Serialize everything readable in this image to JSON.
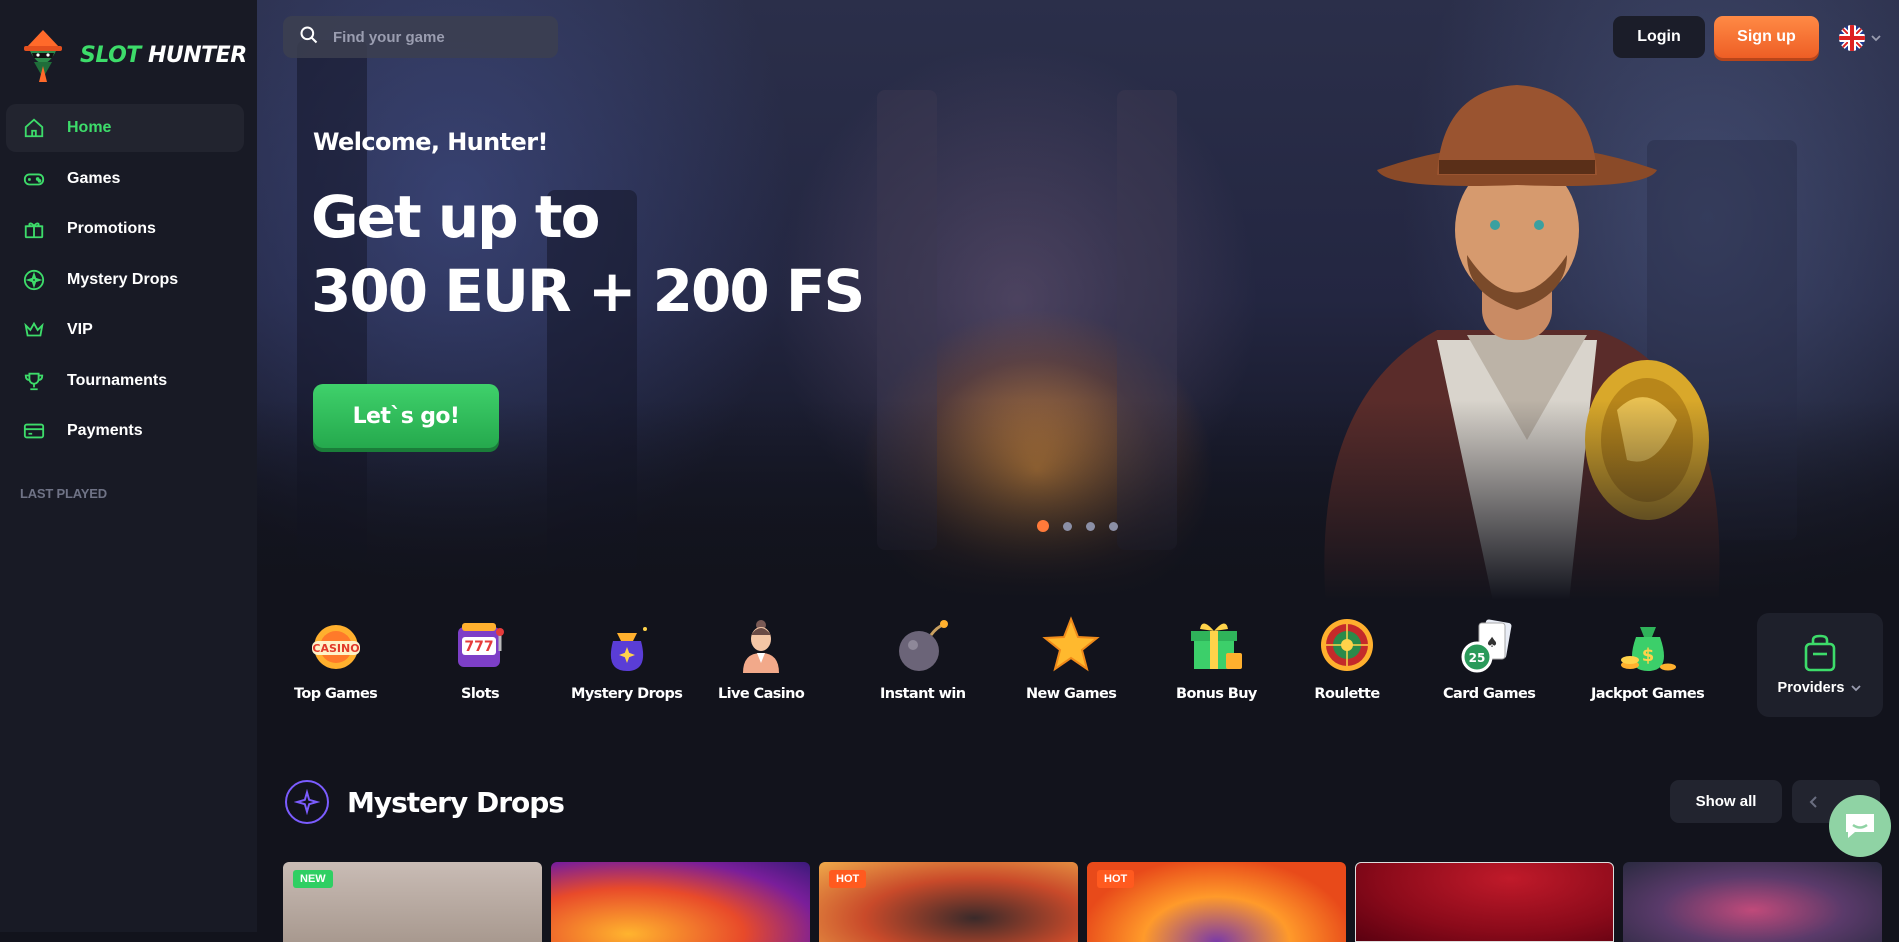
{
  "brand": {
    "part1": "SLOT",
    "part2": "HUNTER"
  },
  "nav": [
    {
      "label": "Home",
      "icon": "home-icon"
    },
    {
      "label": "Games",
      "icon": "gamepad-icon"
    },
    {
      "label": "Promotions",
      "icon": "gift-icon"
    },
    {
      "label": "Mystery Drops",
      "icon": "mystery-drops-icon"
    },
    {
      "label": "VIP",
      "icon": "crown-icon"
    },
    {
      "label": "Tournaments",
      "icon": "trophy-icon"
    },
    {
      "label": "Payments",
      "icon": "card-icon"
    }
  ],
  "last_played_label": "LAST PLAYED",
  "search": {
    "placeholder": "Find your game"
  },
  "header": {
    "login": "Login",
    "signup": "Sign up",
    "language": "flag-uk-icon"
  },
  "hero": {
    "welcome": "Welcome, Hunter!",
    "headline_line1": "Get up to",
    "headline_line2": "300 EUR + 200 FS",
    "cta": "Let`s go!",
    "slides": 4,
    "active_slide": 1
  },
  "categories": [
    {
      "label": "Top Games",
      "icon": "casino-icon"
    },
    {
      "label": "Slots",
      "icon": "slot-machine-icon"
    },
    {
      "label": "Mystery Drops",
      "icon": "mystery-bag-icon"
    },
    {
      "label": "Live Casino",
      "icon": "dealer-icon"
    },
    {
      "label": "Instant win",
      "icon": "bomb-icon"
    },
    {
      "label": "New Games",
      "icon": "star-icon"
    },
    {
      "label": "Bonus Buy",
      "icon": "gift-box-icon"
    },
    {
      "label": "Roulette",
      "icon": "roulette-icon"
    },
    {
      "label": "Card Games",
      "icon": "cards-chip-icon"
    },
    {
      "label": "Jackpot Games",
      "icon": "money-bag-icon"
    }
  ],
  "providers_label": "Providers",
  "section": {
    "title": "Mystery Drops",
    "show_all": "Show all"
  },
  "game_cards": [
    {
      "badge": "NEW"
    },
    {
      "badge": ""
    },
    {
      "badge": "HOT"
    },
    {
      "badge": "HOT"
    },
    {
      "badge": ""
    },
    {
      "badge": ""
    }
  ],
  "colors": {
    "accent_green": "#3ddc6a",
    "accent_orange": "#ff7a3a",
    "bg": "#12131c",
    "sidebar": "#181a25",
    "mystery_purple": "#7b5cff"
  }
}
